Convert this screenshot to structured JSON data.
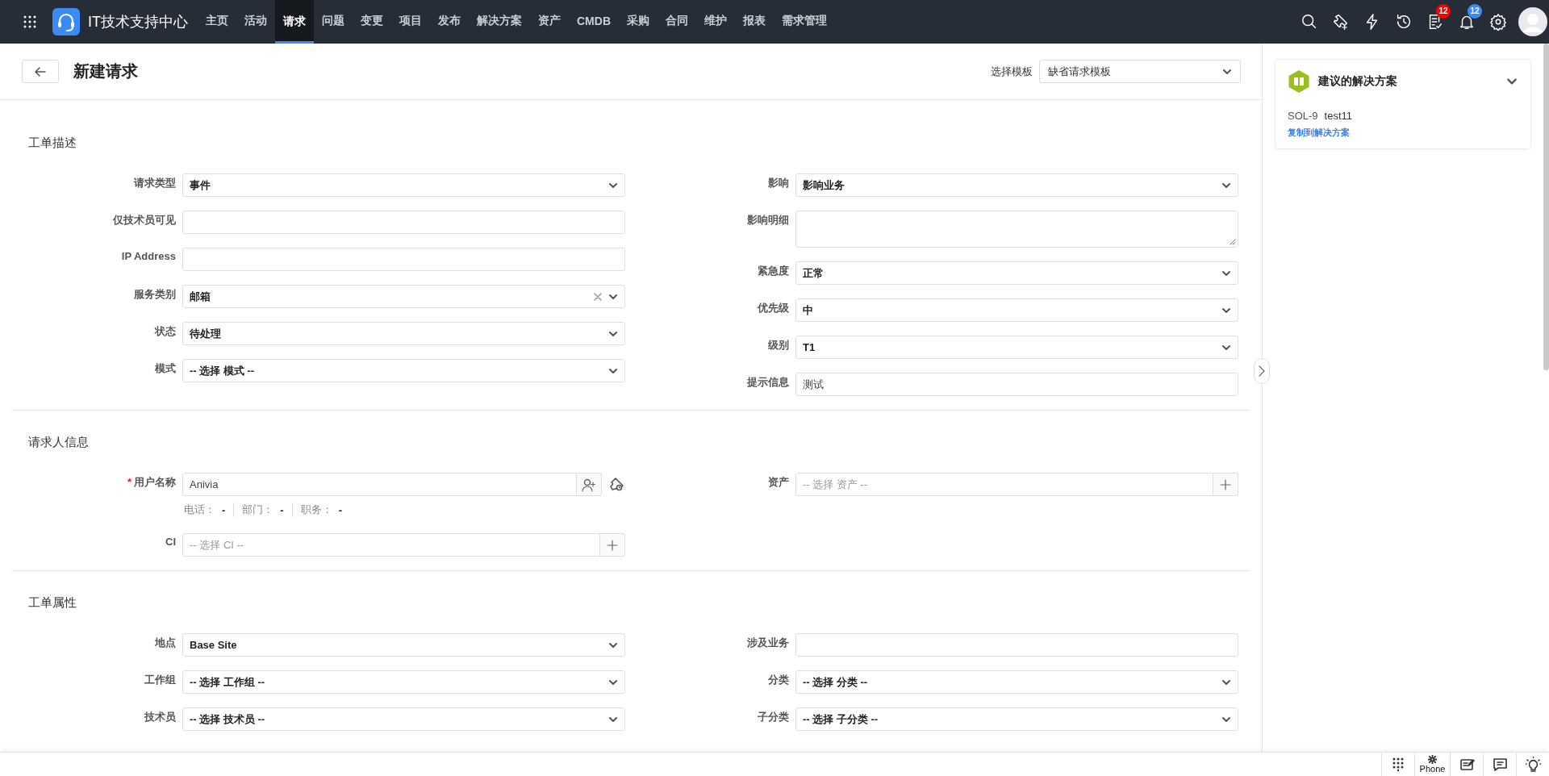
{
  "nav": {
    "app_title": "IT技术支持中心",
    "tabs": [
      {
        "label": "主页",
        "selected": false
      },
      {
        "label": "活动",
        "selected": false
      },
      {
        "label": "请求",
        "selected": true
      },
      {
        "label": "问题",
        "selected": false
      },
      {
        "label": "变更",
        "selected": false
      },
      {
        "label": "项目",
        "selected": false
      },
      {
        "label": "发布",
        "selected": false
      },
      {
        "label": "解决方案",
        "selected": false
      },
      {
        "label": "资产",
        "selected": false
      },
      {
        "label": "CMDB",
        "selected": false
      },
      {
        "label": "采购",
        "selected": false
      },
      {
        "label": "合同",
        "selected": false
      },
      {
        "label": "维护",
        "selected": false
      },
      {
        "label": "报表",
        "selected": false
      },
      {
        "label": "需求管理",
        "selected": false
      }
    ],
    "tools": [
      {
        "kind": "search"
      },
      {
        "kind": "ticket"
      },
      {
        "kind": "bolt"
      },
      {
        "kind": "history"
      },
      {
        "kind": "tasks",
        "badge": "12",
        "color": "#ff0000"
      },
      {
        "kind": "bell",
        "badge": "12",
        "color": "#3d8af7"
      },
      {
        "kind": "settings"
      },
      {
        "kind": "avatar"
      }
    ]
  },
  "header": {
    "title": "新建请求",
    "template_label": "选择模板",
    "template_value": "缺省请求模板"
  },
  "sections": [
    {
      "title": "工单描述",
      "left": [
        {
          "label": "请求类型",
          "kind": "select",
          "value": "事件"
        },
        {
          "label": "仅技术员可见",
          "kind": "text"
        },
        {
          "label": "IP Address",
          "kind": "text"
        },
        {
          "label": "服务类别",
          "kind": "select",
          "value": "邮箱",
          "clearable": true
        },
        {
          "label": "状态",
          "kind": "select",
          "value": "待处理"
        },
        {
          "label": "模式",
          "kind": "select",
          "value": "-- 选择 模式 --"
        }
      ],
      "right": [
        {
          "label": "影响",
          "kind": "select",
          "value": "影响业务"
        },
        {
          "label": "影响明细",
          "kind": "textarea"
        },
        {
          "label": "紧急度",
          "kind": "select",
          "value": "正常"
        },
        {
          "label": "优先级",
          "kind": "select",
          "value": "中"
        },
        {
          "label": "级别",
          "kind": "select",
          "value": "T1"
        },
        {
          "label": "提示信息",
          "kind": "text",
          "value": "测试"
        }
      ]
    },
    {
      "title": "请求人信息",
      "left": [
        {
          "label": "用户名称",
          "kind": "user",
          "required_mark": "*",
          "value": "Anivia",
          "details": [
            {
              "label": "电话：",
              "value": "-"
            },
            {
              "label": "部门：",
              "value": "-"
            },
            {
              "label": "职务：",
              "value": "-"
            }
          ]
        },
        {
          "label": "CI",
          "kind": "lookup",
          "placeholder": "-- 选择 CI --"
        }
      ],
      "right": [
        {
          "label": "资产",
          "kind": "lookup",
          "placeholder": "-- 选择 资产 --"
        }
      ]
    },
    {
      "title": "工单属性",
      "left": [
        {
          "label": "地点",
          "kind": "select",
          "value": "Base Site"
        },
        {
          "label": "工作组",
          "kind": "select",
          "value": "-- 选择 工作组 --"
        },
        {
          "label": "技术员",
          "kind": "select",
          "value": "-- 选择 技术员 --"
        }
      ],
      "right": [
        {
          "label": "涉及业务",
          "kind": "text"
        },
        {
          "label": "分类",
          "kind": "select",
          "value": "-- 选择 分类 --"
        },
        {
          "label": "子分类",
          "kind": "select",
          "value": "-- 选择 子分类 --"
        }
      ]
    }
  ],
  "side_panel": {
    "title": "建议的解决方案",
    "items": [
      {
        "id": "SOL-9",
        "title": "test11",
        "action": "复制到解决方案"
      }
    ]
  },
  "bottom_bar": [
    {
      "kind": "dialpad"
    },
    {
      "kind": "phone",
      "label": "Phone"
    },
    {
      "kind": "note"
    },
    {
      "kind": "chat"
    },
    {
      "kind": "bulb"
    }
  ]
}
